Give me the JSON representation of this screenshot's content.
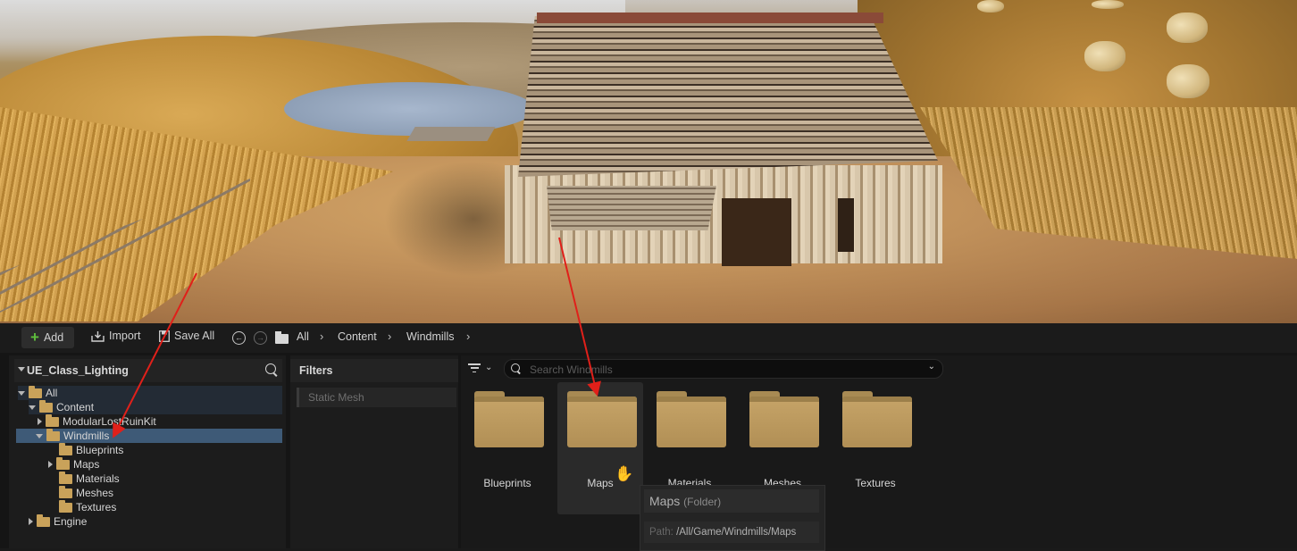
{
  "toolbar": {
    "add_label": "Add",
    "import_label": "Import",
    "save_all_label": "Save All",
    "breadcrumbs": [
      "All",
      "Content",
      "Windmills"
    ]
  },
  "tree": {
    "title": "UE_Class_Lighting",
    "items": [
      {
        "label": "All"
      },
      {
        "label": "Content"
      },
      {
        "label": "ModularLostRuinKit"
      },
      {
        "label": "Windmills"
      },
      {
        "label": "Blueprints"
      },
      {
        "label": "Maps"
      },
      {
        "label": "Materials"
      },
      {
        "label": "Meshes"
      },
      {
        "label": "Textures"
      },
      {
        "label": "Engine"
      }
    ]
  },
  "filters": {
    "title": "Filters",
    "items": [
      "Static Mesh"
    ]
  },
  "search": {
    "placeholder": "Search Windmills"
  },
  "assets": [
    {
      "label": "Blueprints"
    },
    {
      "label": "Maps"
    },
    {
      "label": "Materials"
    },
    {
      "label": "Meshes"
    },
    {
      "label": "Textures"
    }
  ],
  "tooltip": {
    "name": "Maps",
    "type": "(Folder)",
    "path_label": "Path:",
    "path_value": "/All/Game/Windmills/Maps"
  },
  "colors": {
    "selection": "#3e5a77",
    "annotation_arrow": "#e0201a",
    "folder": "#c6a468",
    "add_icon": "#5fbf3d"
  }
}
